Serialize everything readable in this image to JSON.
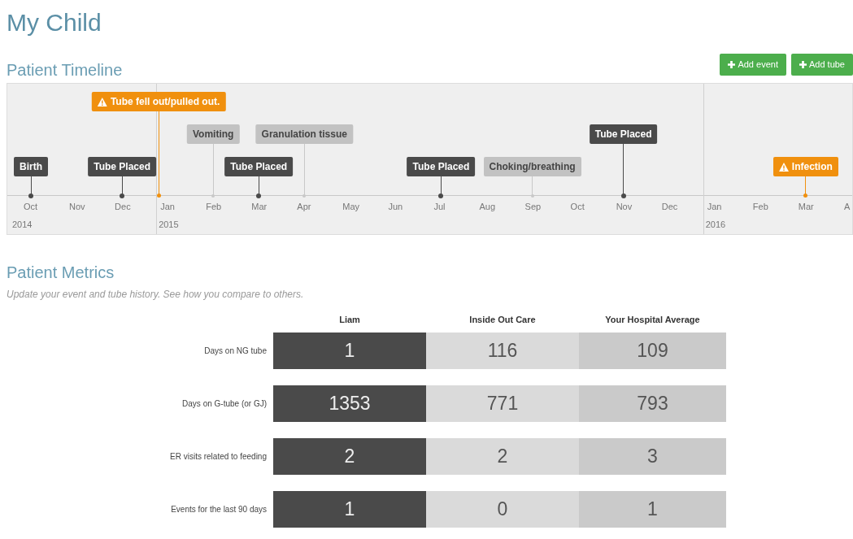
{
  "page_title": "My Child",
  "timeline": {
    "title": "Patient Timeline",
    "buttons": [
      {
        "label": "Add event"
      },
      {
        "label": "Add tube"
      }
    ],
    "months": [
      {
        "label": "Oct",
        "year": "2014",
        "events": [
          {
            "label": "Birth",
            "kind": "milestone",
            "raised": false
          }
        ]
      },
      {
        "label": "Nov"
      },
      {
        "label": "Dec",
        "events": [
          {
            "label": "Tube Placed",
            "kind": "milestone",
            "raised": false
          }
        ]
      },
      {
        "label": "Jan",
        "year": "2015",
        "events": [
          {
            "label": "Tube fell out/pulled out.",
            "kind": "alert",
            "raised": true
          }
        ]
      },
      {
        "label": "Feb",
        "events": [
          {
            "label": "Vomiting",
            "kind": "issue",
            "raised": true
          }
        ]
      },
      {
        "label": "Mar",
        "events": [
          {
            "label": "Tube Placed",
            "kind": "milestone",
            "raised": false
          }
        ]
      },
      {
        "label": "Apr",
        "events": [
          {
            "label": "Granulation tissue",
            "kind": "issue",
            "raised": true
          }
        ]
      },
      {
        "label": "May"
      },
      {
        "label": "Jun"
      },
      {
        "label": "Jul",
        "events": [
          {
            "label": "Tube Placed",
            "kind": "milestone",
            "raised": false
          }
        ]
      },
      {
        "label": "Aug"
      },
      {
        "label": "Sep",
        "events": [
          {
            "label": "Choking/breathing",
            "kind": "issue",
            "raised": false
          }
        ]
      },
      {
        "label": "Oct"
      },
      {
        "label": "Nov",
        "events": [
          {
            "label": "Tube Placed",
            "kind": "milestone",
            "raised": true
          }
        ]
      },
      {
        "label": "Dec"
      },
      {
        "label": "Jan",
        "year": "2016"
      },
      {
        "label": "Feb"
      },
      {
        "label": "Mar",
        "events": [
          {
            "label": "Infection",
            "kind": "alert",
            "raised": false
          }
        ]
      },
      {
        "label": "A"
      }
    ]
  },
  "metrics": {
    "title": "Patient Metrics",
    "subtitle": "Update your event and tube history. See how you compare to others.",
    "columns": [
      "Liam",
      "Inside Out Care",
      "Your Hospital Average"
    ],
    "rows": [
      {
        "label": "Days on NG tube",
        "values": [
          "1",
          "116",
          "109"
        ]
      },
      {
        "label": "Days on G-tube (or GJ)",
        "values": [
          "1353",
          "771",
          "793"
        ]
      },
      {
        "label": "ER visits related to feeding",
        "values": [
          "2",
          "2",
          "3"
        ]
      },
      {
        "label": "Events for the last 90 days",
        "values": [
          "1",
          "0",
          "1"
        ]
      }
    ]
  }
}
